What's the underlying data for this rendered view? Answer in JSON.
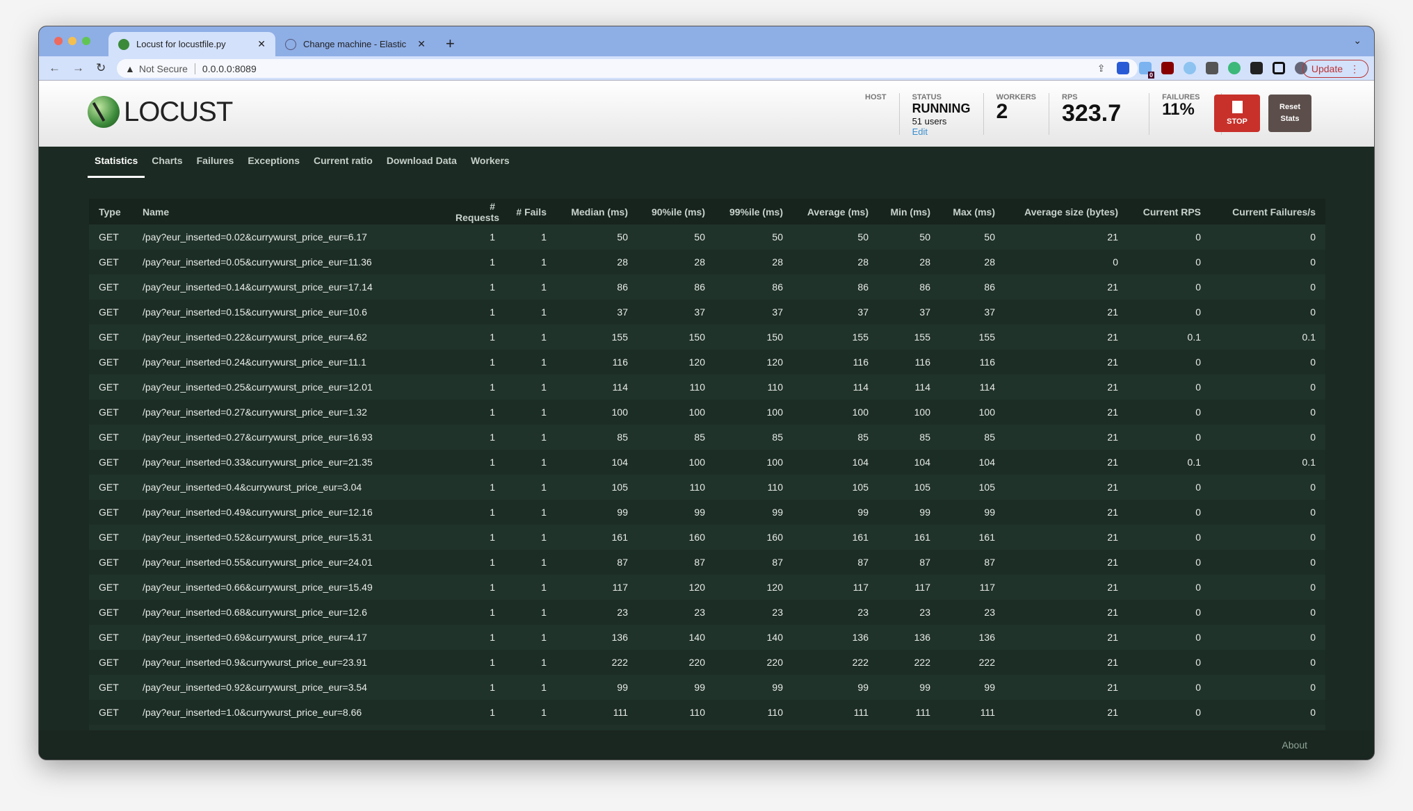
{
  "browser": {
    "tabs": [
      {
        "title": "Locust for locustfile.py",
        "active": true
      },
      {
        "title": "Change machine - Elastic",
        "active": false
      }
    ],
    "security": "Not Secure",
    "url": "0.0.0.0:8089",
    "update_label": "Update",
    "extension_badge": "0"
  },
  "header": {
    "logo": "LOCUST",
    "host": {
      "label": "HOST",
      "value": ""
    },
    "status": {
      "label": "STATUS",
      "value": "RUNNING",
      "users": "51 users",
      "edit": "Edit"
    },
    "workers": {
      "label": "WORKERS",
      "value": "2"
    },
    "rps": {
      "label": "RPS",
      "value": "323.7"
    },
    "failures": {
      "label": "FAILURES",
      "value": "11%"
    },
    "stop_label": "STOP",
    "reset_label": "Reset Stats"
  },
  "nav": [
    "Statistics",
    "Charts",
    "Failures",
    "Exceptions",
    "Current ratio",
    "Download Data",
    "Workers"
  ],
  "table": {
    "columns": [
      "Type",
      "Name",
      "# Requests",
      "# Fails",
      "Median (ms)",
      "90%ile (ms)",
      "99%ile (ms)",
      "Average (ms)",
      "Min (ms)",
      "Max (ms)",
      "Average size (bytes)",
      "Current RPS",
      "Current Failures/s"
    ],
    "rows": [
      [
        "GET",
        "/pay?eur_inserted=0.02&currywurst_price_eur=6.17",
        "1",
        "1",
        "50",
        "50",
        "50",
        "50",
        "50",
        "50",
        "21",
        "0",
        "0"
      ],
      [
        "GET",
        "/pay?eur_inserted=0.05&currywurst_price_eur=11.36",
        "1",
        "1",
        "28",
        "28",
        "28",
        "28",
        "28",
        "28",
        "0",
        "0",
        "0"
      ],
      [
        "GET",
        "/pay?eur_inserted=0.14&currywurst_price_eur=17.14",
        "1",
        "1",
        "86",
        "86",
        "86",
        "86",
        "86",
        "86",
        "21",
        "0",
        "0"
      ],
      [
        "GET",
        "/pay?eur_inserted=0.15&currywurst_price_eur=10.6",
        "1",
        "1",
        "37",
        "37",
        "37",
        "37",
        "37",
        "37",
        "21",
        "0",
        "0"
      ],
      [
        "GET",
        "/pay?eur_inserted=0.22&currywurst_price_eur=4.62",
        "1",
        "1",
        "155",
        "150",
        "150",
        "155",
        "155",
        "155",
        "21",
        "0.1",
        "0.1"
      ],
      [
        "GET",
        "/pay?eur_inserted=0.24&currywurst_price_eur=11.1",
        "1",
        "1",
        "116",
        "120",
        "120",
        "116",
        "116",
        "116",
        "21",
        "0",
        "0"
      ],
      [
        "GET",
        "/pay?eur_inserted=0.25&currywurst_price_eur=12.01",
        "1",
        "1",
        "114",
        "110",
        "110",
        "114",
        "114",
        "114",
        "21",
        "0",
        "0"
      ],
      [
        "GET",
        "/pay?eur_inserted=0.27&currywurst_price_eur=1.32",
        "1",
        "1",
        "100",
        "100",
        "100",
        "100",
        "100",
        "100",
        "21",
        "0",
        "0"
      ],
      [
        "GET",
        "/pay?eur_inserted=0.27&currywurst_price_eur=16.93",
        "1",
        "1",
        "85",
        "85",
        "85",
        "85",
        "85",
        "85",
        "21",
        "0",
        "0"
      ],
      [
        "GET",
        "/pay?eur_inserted=0.33&currywurst_price_eur=21.35",
        "1",
        "1",
        "104",
        "100",
        "100",
        "104",
        "104",
        "104",
        "21",
        "0.1",
        "0.1"
      ],
      [
        "GET",
        "/pay?eur_inserted=0.4&currywurst_price_eur=3.04",
        "1",
        "1",
        "105",
        "110",
        "110",
        "105",
        "105",
        "105",
        "21",
        "0",
        "0"
      ],
      [
        "GET",
        "/pay?eur_inserted=0.49&currywurst_price_eur=12.16",
        "1",
        "1",
        "99",
        "99",
        "99",
        "99",
        "99",
        "99",
        "21",
        "0",
        "0"
      ],
      [
        "GET",
        "/pay?eur_inserted=0.52&currywurst_price_eur=15.31",
        "1",
        "1",
        "161",
        "160",
        "160",
        "161",
        "161",
        "161",
        "21",
        "0",
        "0"
      ],
      [
        "GET",
        "/pay?eur_inserted=0.55&currywurst_price_eur=24.01",
        "1",
        "1",
        "87",
        "87",
        "87",
        "87",
        "87",
        "87",
        "21",
        "0",
        "0"
      ],
      [
        "GET",
        "/pay?eur_inserted=0.66&currywurst_price_eur=15.49",
        "1",
        "1",
        "117",
        "120",
        "120",
        "117",
        "117",
        "117",
        "21",
        "0",
        "0"
      ],
      [
        "GET",
        "/pay?eur_inserted=0.68&currywurst_price_eur=12.6",
        "1",
        "1",
        "23",
        "23",
        "23",
        "23",
        "23",
        "23",
        "21",
        "0",
        "0"
      ],
      [
        "GET",
        "/pay?eur_inserted=0.69&currywurst_price_eur=4.17",
        "1",
        "1",
        "136",
        "140",
        "140",
        "136",
        "136",
        "136",
        "21",
        "0",
        "0"
      ],
      [
        "GET",
        "/pay?eur_inserted=0.9&currywurst_price_eur=23.91",
        "1",
        "1",
        "222",
        "220",
        "220",
        "222",
        "222",
        "222",
        "21",
        "0",
        "0"
      ],
      [
        "GET",
        "/pay?eur_inserted=0.92&currywurst_price_eur=3.54",
        "1",
        "1",
        "99",
        "99",
        "99",
        "99",
        "99",
        "99",
        "21",
        "0",
        "0"
      ],
      [
        "GET",
        "/pay?eur_inserted=1.0&currywurst_price_eur=8.66",
        "1",
        "1",
        "111",
        "110",
        "110",
        "111",
        "111",
        "111",
        "21",
        "0",
        "0"
      ]
    ]
  },
  "footer": {
    "about": "About"
  }
}
